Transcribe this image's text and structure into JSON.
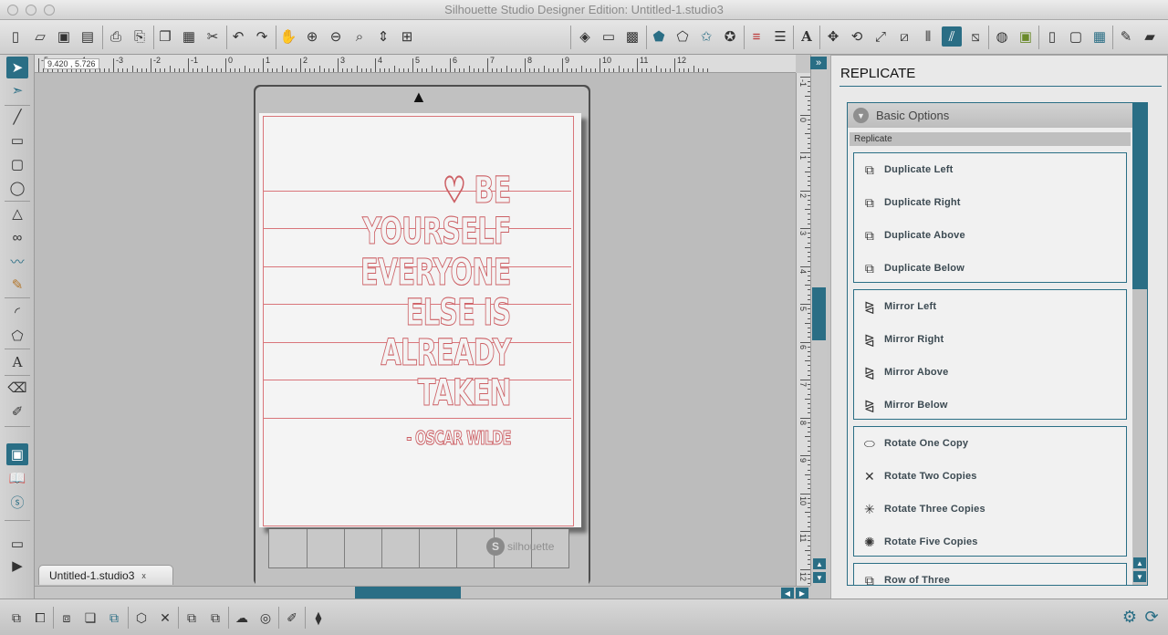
{
  "window": {
    "title": "Silhouette Studio Designer Edition: Untitled-1.studio3"
  },
  "toolbar": {
    "left_icons": [
      "new-document-icon",
      "open-folder-icon",
      "save-icon",
      "save-to-sd-icon",
      "print-icon",
      "print-and-cut-icon",
      "copy-icon",
      "paste-icon",
      "cut-icon",
      "undo-icon",
      "redo-icon",
      "pan-hand-icon",
      "zoom-in-icon",
      "zoom-out-icon",
      "zoom-select-icon",
      "drag-zoom-icon",
      "fit-to-page-icon"
    ],
    "right_icons": [
      "fill-color-icon",
      "fill-gradient-icon",
      "fill-pattern-icon",
      "line-color-icon",
      "line-style-icon",
      "line-thickness-icon",
      "point-edit-icon",
      "lines-color-icon",
      "line-weight-icon",
      "text-style-icon",
      "transform-icon",
      "rotate-icon",
      "scale-icon",
      "shear-icon",
      "align-icon",
      "replicate-icon",
      "modify-icon",
      "offset-icon",
      "trace-icon",
      "page-setup-icon",
      "cut-settings-icon",
      "send-to-icon",
      "registration-icon",
      "design-store-icon",
      "library-icon"
    ]
  },
  "coords": "9.420 , 5.726",
  "ruler": {
    "h_labels": [
      "-5",
      "-4",
      "-3",
      "-2",
      "-1",
      "0",
      "1",
      "2",
      "3",
      "4",
      "5",
      "6",
      "7",
      "8",
      "9",
      "10",
      "11",
      "12"
    ],
    "v_labels": [
      "-1",
      "0",
      "1",
      "2",
      "3",
      "4",
      "5",
      "6",
      "7",
      "8",
      "9",
      "10",
      "11",
      "12"
    ]
  },
  "canvas": {
    "quote_lines": [
      "♡ BE",
      "YOURSELF",
      "EVERYONE",
      "ELSE IS",
      "ALREADY",
      "TAKEN"
    ],
    "attribution": "- OSCAR WILDE",
    "mat_brand": "silhouette",
    "mat_logo_letter": "S"
  },
  "document_tab": {
    "label": "Untitled-1.studio3",
    "close": "x"
  },
  "panel": {
    "title": "REPLICATE",
    "section_title": "Basic Options",
    "subsection": "Replicate",
    "groups": [
      {
        "items": [
          {
            "label": "Duplicate Left",
            "icon": "duplicate-left-icon"
          },
          {
            "label": "Duplicate Right",
            "icon": "duplicate-right-icon"
          },
          {
            "label": "Duplicate Above",
            "icon": "duplicate-above-icon"
          },
          {
            "label": "Duplicate Below",
            "icon": "duplicate-below-icon"
          }
        ]
      },
      {
        "items": [
          {
            "label": "Mirror Left",
            "icon": "mirror-left-icon"
          },
          {
            "label": "Mirror Right",
            "icon": "mirror-right-icon"
          },
          {
            "label": "Mirror Above",
            "icon": "mirror-above-icon"
          },
          {
            "label": "Mirror Below",
            "icon": "mirror-below-icon"
          }
        ]
      },
      {
        "items": [
          {
            "label": "Rotate One Copy",
            "icon": "rotate-one-copy-icon"
          },
          {
            "label": "Rotate Two Copies",
            "icon": "rotate-two-copies-icon"
          },
          {
            "label": "Rotate Three Copies",
            "icon": "rotate-three-copies-icon"
          },
          {
            "label": "Rotate Five Copies",
            "icon": "rotate-five-copies-icon"
          }
        ]
      },
      {
        "items": [
          {
            "label": "Row of Three",
            "icon": "row-of-three-icon"
          }
        ]
      }
    ]
  },
  "colors": {
    "accent": "#2a6e85",
    "cut_line": "#d9757a"
  }
}
